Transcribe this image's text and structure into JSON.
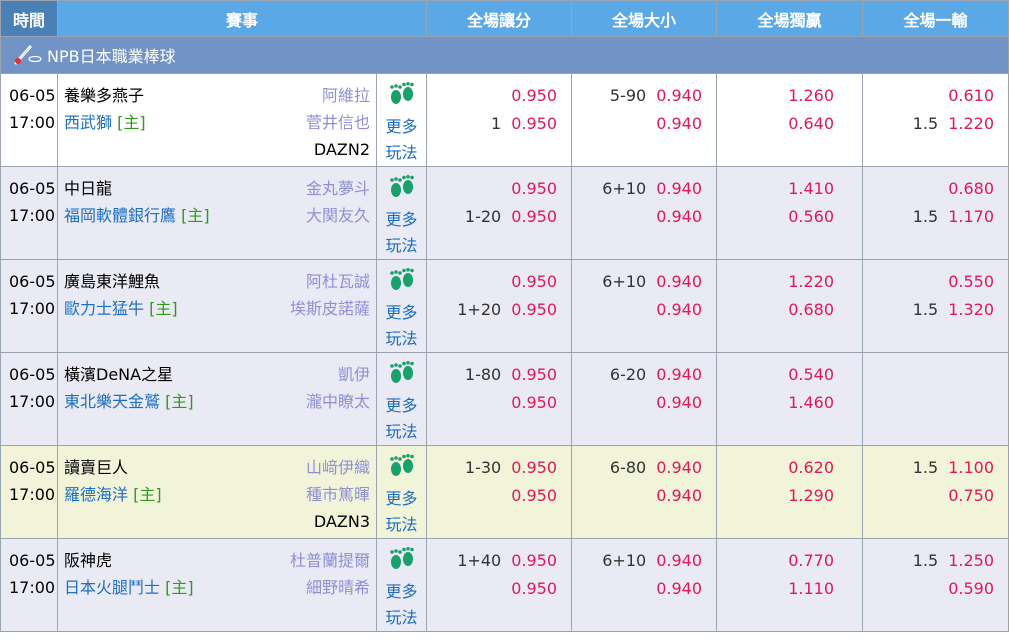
{
  "headers": {
    "time": "時間",
    "event": "賽事",
    "handicap": "全場讓分",
    "total": "全場大小",
    "moneyline": "全場獨贏",
    "runline": "全場一輸"
  },
  "league": {
    "name": "NPB日本職業棒球",
    "icon": "baseball-bat-icon"
  },
  "more_label_1": "更多",
  "more_label_2": "玩法",
  "more_icon": "footprints-icon",
  "home_tag": "[主]",
  "colors": {
    "header_bg": "#5aa9e6",
    "league_bg": "#7293c5",
    "odds": "#e0195a",
    "home_team": "#1b6ec2",
    "pitcher": "#8f8fd6"
  },
  "matches": [
    {
      "date": "06-05",
      "time": "17:00",
      "away": "養樂多燕子",
      "home": "西武獅",
      "away_pitcher": "阿維拉",
      "home_pitcher": "菅井信也",
      "tv": "DAZN2",
      "hcp_line": [
        "",
        "1"
      ],
      "hcp_odds": [
        "0.950",
        "0.950"
      ],
      "ou_line": [
        "5-90",
        ""
      ],
      "ou_odds": [
        "0.940",
        "0.940"
      ],
      "ml_odds": [
        "1.260",
        "0.640"
      ],
      "rl_line": [
        "",
        "1.5"
      ],
      "rl_odds": [
        "0.610",
        "1.220"
      ]
    },
    {
      "date": "06-05",
      "time": "17:00",
      "away": "中日龍",
      "home": "福岡軟體銀行鷹",
      "away_pitcher": "金丸夢斗",
      "home_pitcher": "大関友久",
      "tv": "",
      "hcp_line": [
        "",
        "1-20"
      ],
      "hcp_odds": [
        "0.950",
        "0.950"
      ],
      "ou_line": [
        "6+10",
        ""
      ],
      "ou_odds": [
        "0.940",
        "0.940"
      ],
      "ml_odds": [
        "1.410",
        "0.560"
      ],
      "rl_line": [
        "",
        "1.5"
      ],
      "rl_odds": [
        "0.680",
        "1.170"
      ]
    },
    {
      "date": "06-05",
      "time": "17:00",
      "away": "廣島東洋鯉魚",
      "home": "歐力士猛牛",
      "away_pitcher": "阿杜瓦誠",
      "home_pitcher": "埃斯皮諾薩",
      "tv": "",
      "hcp_line": [
        "",
        "1+20"
      ],
      "hcp_odds": [
        "0.950",
        "0.950"
      ],
      "ou_line": [
        "6+10",
        ""
      ],
      "ou_odds": [
        "0.940",
        "0.940"
      ],
      "ml_odds": [
        "1.220",
        "0.680"
      ],
      "rl_line": [
        "",
        "1.5"
      ],
      "rl_odds": [
        "0.550",
        "1.320"
      ]
    },
    {
      "date": "06-05",
      "time": "17:00",
      "away": "橫濱DeNA之星",
      "home": "東北樂天金鷲",
      "away_pitcher": "凱伊",
      "home_pitcher": "瀧中瞭太",
      "tv": "",
      "hcp_line": [
        "1-80",
        ""
      ],
      "hcp_odds": [
        "0.950",
        "0.950"
      ],
      "ou_line": [
        "6-20",
        ""
      ],
      "ou_odds": [
        "0.940",
        "0.940"
      ],
      "ml_odds": [
        "0.540",
        "1.460"
      ],
      "rl_line": [
        "",
        ""
      ],
      "rl_odds": [
        "",
        ""
      ]
    },
    {
      "date": "06-05",
      "time": "17:00",
      "away": "讀賣巨人",
      "home": "羅德海洋",
      "away_pitcher": "山﨑伊織",
      "home_pitcher": "種市篤暉",
      "tv": "DAZN3",
      "hcp_line": [
        "1-30",
        ""
      ],
      "hcp_odds": [
        "0.950",
        "0.950"
      ],
      "ou_line": [
        "6-80",
        ""
      ],
      "ou_odds": [
        "0.940",
        "0.940"
      ],
      "ml_odds": [
        "0.620",
        "1.290"
      ],
      "rl_line": [
        "1.5",
        ""
      ],
      "rl_odds": [
        "1.100",
        "0.750"
      ]
    },
    {
      "date": "06-05",
      "time": "17:00",
      "away": "阪神虎",
      "home": "日本火腿鬥士",
      "away_pitcher": "杜普蘭提爾",
      "home_pitcher": "細野晴希",
      "tv": "",
      "hcp_line": [
        "1+40",
        ""
      ],
      "hcp_odds": [
        "0.950",
        "0.950"
      ],
      "ou_line": [
        "6+10",
        ""
      ],
      "ou_odds": [
        "0.940",
        "0.940"
      ],
      "ml_odds": [
        "0.770",
        "1.110"
      ],
      "rl_line": [
        "1.5",
        ""
      ],
      "rl_odds": [
        "1.250",
        "0.590"
      ]
    }
  ]
}
